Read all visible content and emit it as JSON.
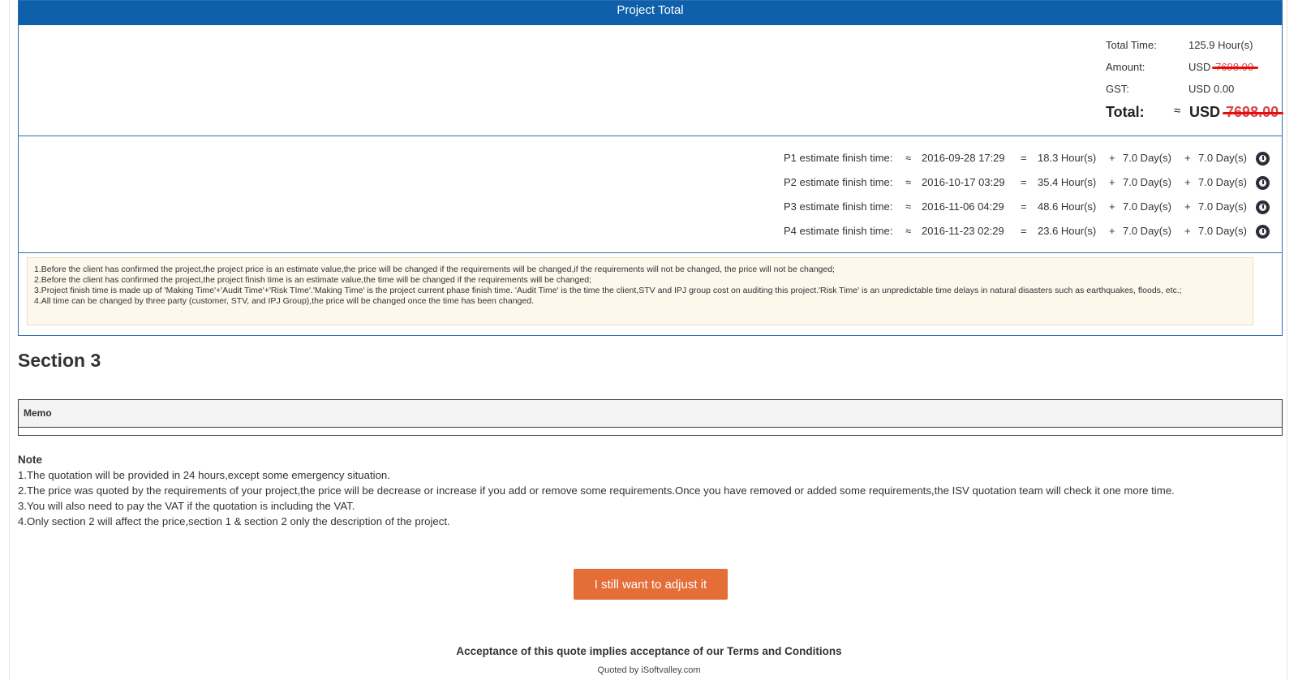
{
  "project_total": {
    "header": "Project Total",
    "total_time_label": "Total Time:",
    "total_time_value": "125.9 Hour(s)",
    "amount_label": "Amount:",
    "amount_currency": "USD",
    "amount_value": "7698.00",
    "gst_label": "GST:",
    "gst_value": "USD 0.00",
    "total_label": "Total:",
    "total_approx": "≈",
    "total_currency": "USD",
    "total_value": "7698.00"
  },
  "estimates": [
    {
      "label": "P1 estimate finish time:",
      "approx": "≈",
      "datetime": "2016-09-28 17:29",
      "eq": "=",
      "hours": "18.3 Hour(s)",
      "plus1": "+",
      "days1": "7.0 Day(s)",
      "plus2": "+",
      "days2": "7.0 Day(s)"
    },
    {
      "label": "P2 estimate finish time:",
      "approx": "≈",
      "datetime": "2016-10-17 03:29",
      "eq": "=",
      "hours": "35.4 Hour(s)",
      "plus1": "+",
      "days1": "7.0 Day(s)",
      "plus2": "+",
      "days2": "7.0 Day(s)"
    },
    {
      "label": "P3 estimate finish time:",
      "approx": "≈",
      "datetime": "2016-11-06 04:29",
      "eq": "=",
      "hours": "48.6 Hour(s)",
      "plus1": "+",
      "days1": "7.0 Day(s)",
      "plus2": "+",
      "days2": "7.0 Day(s)"
    },
    {
      "label": "P4 estimate finish time:",
      "approx": "≈",
      "datetime": "2016-11-23 02:29",
      "eq": "=",
      "hours": "23.6 Hour(s)",
      "plus1": "+",
      "days1": "7.0 Day(s)",
      "plus2": "+",
      "days2": "7.0 Day(s)"
    }
  ],
  "disclaimer": [
    "1.Before the client has confirmed the project,the project price is an estimate value,the price will be changed if the requirements will be changed,if the requirements will not be changed, the price will not be changed;",
    "2.Before the client has confirmed the project,the project finish time is an estimate value,the time will be changed if the requirements will be changed;",
    "3.Project finish time is made up of 'Making Time'+'Audit Time'+'Risk TIme'.'Making Time' is the project current phase finish time. 'Audit Time' is the time the client,STV and IPJ group cost on auditing this project.'Risk Time' is an unpredictable time delays in natural disasters such as earthquakes, floods, etc.;",
    "4.All time can be changed by three party (customer, STV, and IPJ Group),the price will be changed once the time has been changed."
  ],
  "section3": {
    "title": "Section 3",
    "memo_header": "Memo"
  },
  "note": {
    "title": "Note",
    "lines": [
      "1.The quotation will be provided in 24 hours,except some emergency situation.",
      "2.The price was quoted by the requirements of your project,the price will be decrease or increase if you add or remove some requirements.Once you have removed or added some requirements,the ISV quotation team will check it one more time.",
      "3.You will also need to pay the VAT if the quotation is including the VAT.",
      "4.Only section 2 will affect the price,section 1 & section 2 only the description of the project."
    ]
  },
  "adjust_button_label": "I still want to adjust it",
  "footer": {
    "acceptance": "Acceptance of this quote implies acceptance of our Terms and Conditions",
    "quoted_by": "Quoted by iSoftvalley.com"
  },
  "colors": {
    "header_blue": "#0e60ab",
    "button_orange": "#e46d38",
    "strike_red": "#e01010"
  }
}
